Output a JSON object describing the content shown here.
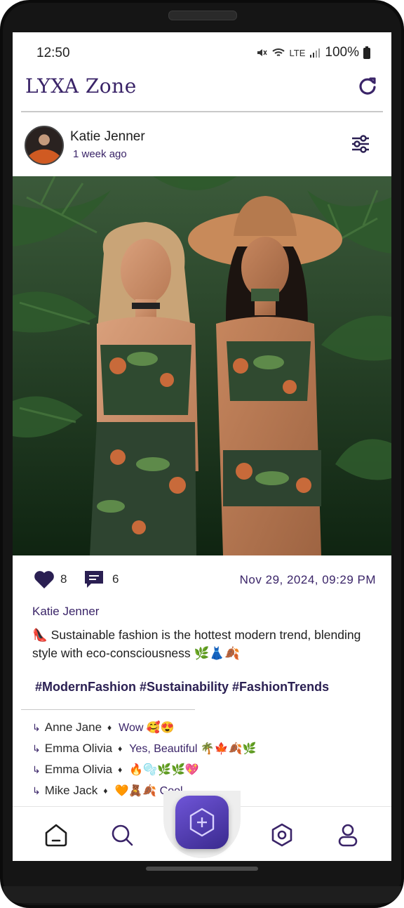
{
  "status_bar": {
    "time": "12:50",
    "battery": "100%",
    "network": "LTE"
  },
  "app": {
    "title": "LYXA Zone"
  },
  "post": {
    "author": "Katie Jenner",
    "posted_ago": "1 week ago",
    "likes": "8",
    "comments_count": "6",
    "date": "Nov 29, 2024, 09:29 PM",
    "caption_author": "Katie Jenner",
    "caption": "👠 Sustainable fashion is the hottest modern trend, blending style with eco-consciousness 🌿👗🍂",
    "hashtags": "#ModernFashion #Sustainability #FashionTrends"
  },
  "comments": [
    {
      "name": "Anne Jane",
      "text": "Wow 🥰😍"
    },
    {
      "name": "Emma Olivia",
      "text": "Yes, Beautiful 🌴🍁🍂🌿"
    },
    {
      "name": "Emma Olivia",
      "text": "🔥🫧🌿🌿💖"
    },
    {
      "name": "Mike Jack",
      "text": "🧡🧸🍂 Cool"
    }
  ],
  "colors": {
    "brand": "#3a2468",
    "fab": "#5a42c4"
  },
  "icons": {
    "nav": [
      "home-icon",
      "search-icon",
      "create-post-icon",
      "explore-icon",
      "profile-icon"
    ]
  }
}
